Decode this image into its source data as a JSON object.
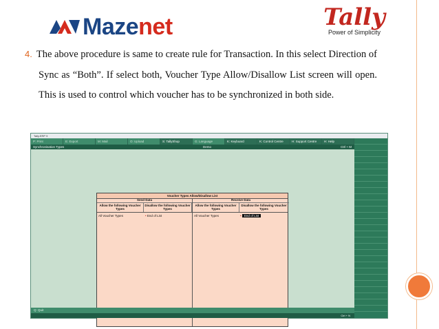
{
  "logos": {
    "mazenet_prefix": "Maze",
    "mazenet_suffix": "net",
    "tally_word": "Tally",
    "tally_tagline": "Power of Simplicity"
  },
  "content": {
    "item_number": "4.",
    "paragraph": "The above procedure is same to create rule for Transaction. In this select Direction of Sync as “Both”. If select both, Voucher Type Allow/Disallow List screen will open. This is used to control which voucher has to be synchronized in both side."
  },
  "tally_window": {
    "title": "Tally.ERP 9",
    "menu": [
      "P: Print",
      "E: Export",
      "M: Mail",
      "O: Upload",
      "S: TallyShop",
      "G: Language",
      "K: Keyboard",
      "K: Control Centre",
      "H: Support Centre",
      "H: Help"
    ],
    "header_left": "Synchronisation Types",
    "header_center": "Demo",
    "header_right": "Ctrl + M",
    "bottom_left": "Q: Quit",
    "status_right": "Ctrl + N",
    "dialog": {
      "title": "Voucher Types Allow/Disallow List",
      "send_group": "Send Data",
      "receive_group": "Receive Data",
      "col_allow": "Allow the following Voucher Types",
      "col_disallow": "Disallow the following Voucher Types",
      "send_allow_value": "All Voucher Types",
      "send_disallow_value": "End of List",
      "receive_allow_value": "All Voucher Types",
      "receive_disallow_value": "End of List"
    }
  },
  "colors": {
    "accent_orange": "#f07a3a",
    "tally_green": "#2b7a5c",
    "dialog_peach": "#fbd9c7"
  }
}
